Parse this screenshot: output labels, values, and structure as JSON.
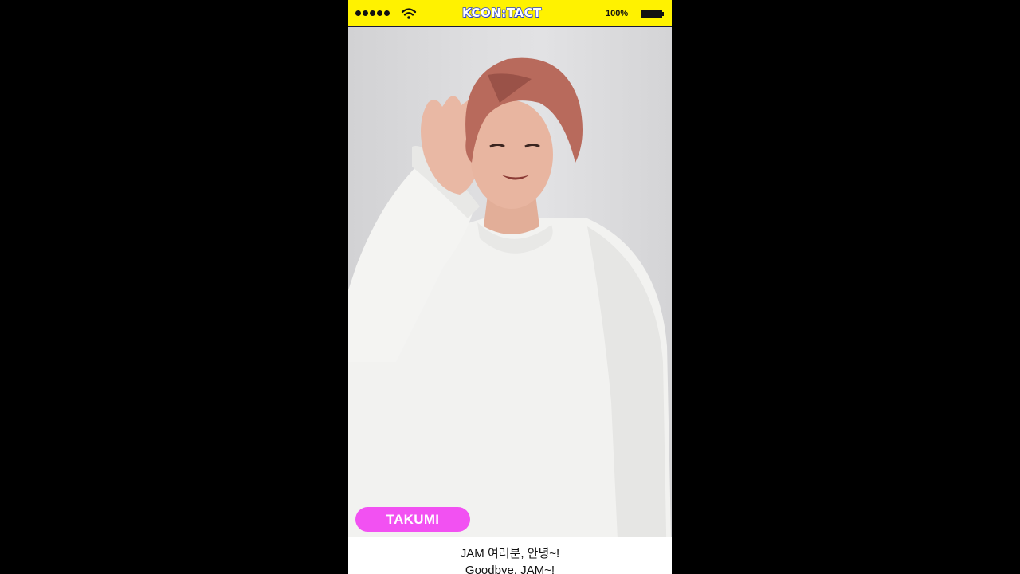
{
  "status_bar": {
    "brand_logo": "KCON:TACT",
    "battery_percent": "100%",
    "signal_icon": "signal-dots-icon",
    "wifi_icon": "wifi-icon",
    "battery_icon": "battery-icon",
    "colors": {
      "bar_background": "#fff200",
      "logo_stroke": "#2b3fd6"
    }
  },
  "video": {
    "name_tag": "TAKUMI",
    "name_tag_color": "#f251f2",
    "subtitle": {
      "korean": "JAM 여러분, 안녕~!",
      "english": "Goodbye, JAM~!"
    }
  }
}
